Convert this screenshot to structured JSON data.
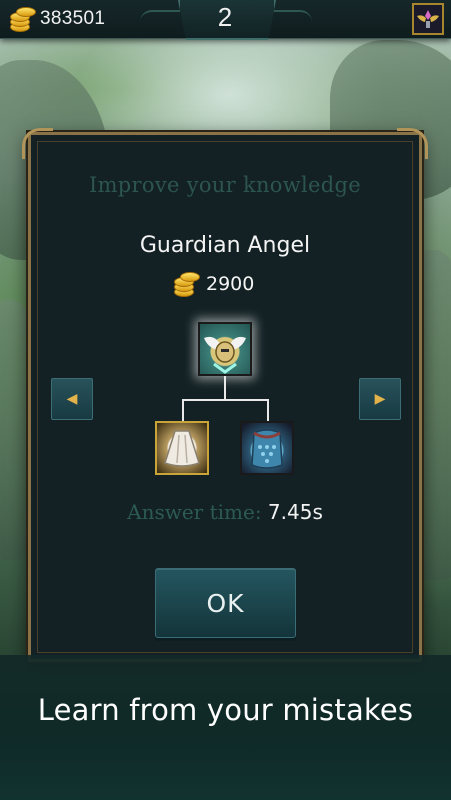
{
  "header": {
    "coins": "383501",
    "round": "2",
    "coin_icon": "gold-coins-icon",
    "profile_icon": "winged-emblem-icon"
  },
  "dialog": {
    "title": "Improve your knowledge",
    "item_name": "Guardian Angel",
    "price": "2900",
    "main_item_icon": "guardian-angel-icon",
    "components": [
      {
        "icon": "cloth-cape-icon"
      },
      {
        "icon": "chain-vest-icon"
      }
    ],
    "nav_prev_glyph": "◀",
    "nav_next_glyph": "▶",
    "answer_label": "Answer time:",
    "answer_value": "7.45s",
    "ok_label": "OK"
  },
  "caption": "Learn from your mistakes",
  "colors": {
    "frame_gold": "#8a7346",
    "dialog_bg": "#132124",
    "muted_teal_text": "#2d5550",
    "button_teal": "#1a4249",
    "arrow_gold": "#e2b34a"
  }
}
